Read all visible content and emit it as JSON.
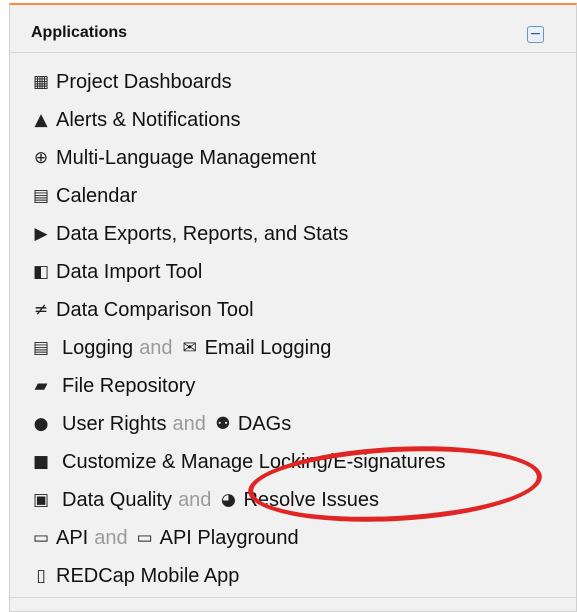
{
  "panel": {
    "title": "Applications",
    "collapse_symbol": "−"
  },
  "items": {
    "project_dashboards": {
      "icon": "monitor-icon",
      "label": "Project Dashboards"
    },
    "alerts": {
      "icon": "bell-icon",
      "label": "Alerts & Notifications"
    },
    "multilang": {
      "icon": "globe-icon",
      "label": "Multi-Language Management"
    },
    "calendar": {
      "icon": "calendar-icon",
      "label": "Calendar"
    },
    "data_exports": {
      "icon": "file-export-icon",
      "label": "Data Exports, Reports, and Stats"
    },
    "data_import": {
      "icon": "file-import-icon",
      "label": "Data Import Tool"
    },
    "data_comparison": {
      "icon": "not-equal-icon",
      "label": "Data Comparison Tool"
    },
    "logging": {
      "icon": "list-icon",
      "label": "Logging",
      "and": "and",
      "second_icon": "envelope-list-icon",
      "second_label": "Email Logging"
    },
    "file_repository": {
      "icon": "folder-open-icon",
      "label": "File Repository"
    },
    "user_rights": {
      "icon": "user-icon",
      "label": "User Rights",
      "and": "and",
      "second_icon": "users-icon",
      "second_label": "DAGs"
    },
    "locking": {
      "icon": "lock-icon",
      "label": "Customize & Manage Locking/E-signatures"
    },
    "data_quality": {
      "icon": "clipboard-check-icon",
      "label": "Data Quality",
      "and": "and",
      "second_icon": "comments-icon",
      "second_label": "Resolve Issues"
    },
    "api": {
      "icon": "api-icon",
      "label": "API",
      "and": "and",
      "second_icon": "api-icon",
      "second_label": "API Playground"
    },
    "mobile_app": {
      "icon": "tablet-icon",
      "label": "REDCap Mobile App"
    }
  },
  "colors": {
    "header_accent": "#ff8a3d",
    "panel_bg": "#f1f1f1",
    "annotation_red": "#e12424",
    "connector_gray": "#9a9a9a"
  }
}
